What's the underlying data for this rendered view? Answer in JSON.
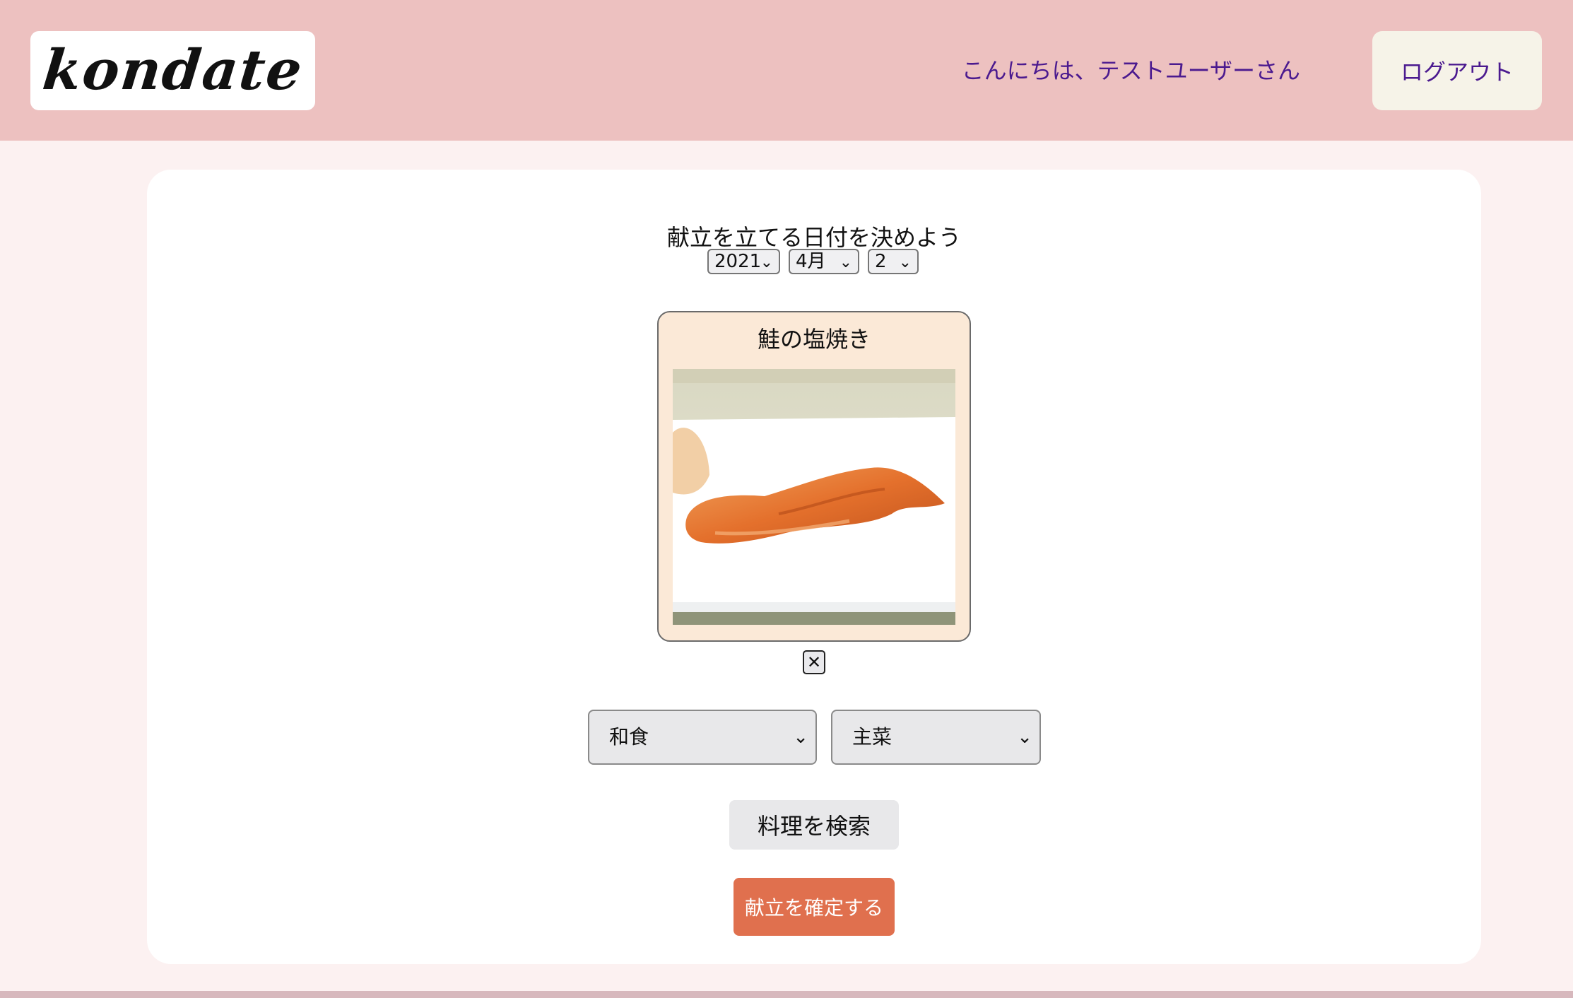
{
  "header": {
    "logo_text": "kondate",
    "greeting": "こんにちは、テストユーザーさん",
    "logout_label": "ログアウト"
  },
  "planner": {
    "heading": "献立を立てる日付を決めよう",
    "year": "2021",
    "month": "4月",
    "day": "2"
  },
  "dish": {
    "name": "鮭の塩焼き",
    "remove_label": "✕"
  },
  "filters": {
    "cuisine": "和食",
    "course": "主菜"
  },
  "actions": {
    "search_label": "料理を検索",
    "confirm_label": "献立を確定する"
  },
  "colors": {
    "header_bg": "#edc1c0",
    "page_bg": "#fcf1f1",
    "card_bg": "#ffffff",
    "dish_card_bg": "#fbe9d7",
    "logout_bg": "#f6f3e8",
    "confirm_bg": "#e0704e",
    "greeting_text": "#4b1a8f"
  },
  "icons": {
    "dropdown": "chevron-down-icon",
    "remove": "close-icon"
  }
}
